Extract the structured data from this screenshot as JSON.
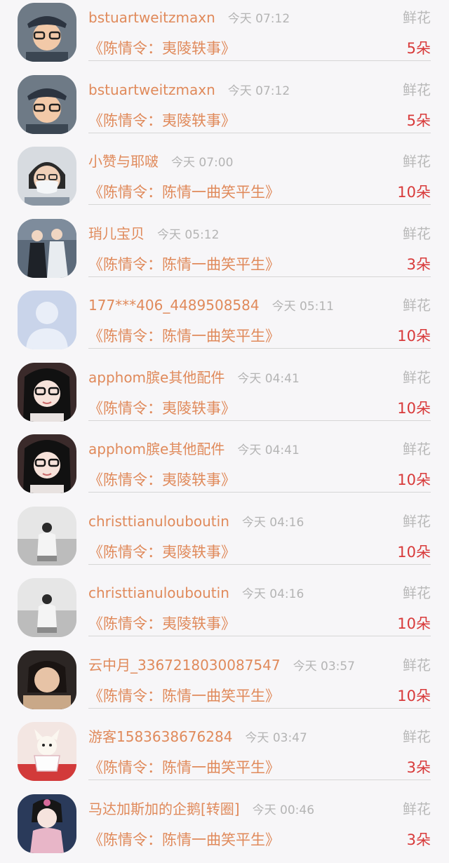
{
  "colors": {
    "background": "#f7f6f8",
    "name": "#e08a5b",
    "time": "#b4b4b4",
    "gift_label": "#b9b9b9",
    "count": "#d83a3a",
    "divider": "#d6d6d6"
  },
  "entries": [
    {
      "name": "bstuartweitzmaxn",
      "time": "今天 07:12",
      "gift": "鲜花",
      "work": "《陈情令：夷陵轶事》",
      "count": "5朵",
      "avatar": "boy-glasses-avatar"
    },
    {
      "name": "bstuartweitzmaxn",
      "time": "今天 07:12",
      "gift": "鲜花",
      "work": "《陈情令：夷陵轶事》",
      "count": "5朵",
      "avatar": "boy-glasses-avatar"
    },
    {
      "name": "小赞与耶啵",
      "time": "今天 07:00",
      "gift": "鲜花",
      "work": "《陈情令：陈情一曲笑平生》",
      "count": "10朵",
      "avatar": "masked-person-avatar"
    },
    {
      "name": "琑儿宝贝",
      "time": "今天 05:12",
      "gift": "鲜花",
      "work": "《陈情令：陈情一曲笑平生》",
      "count": "3朵",
      "avatar": "costume-pair-avatar"
    },
    {
      "name": "177***406_4489508584",
      "time": "今天 05:11",
      "gift": "鲜花",
      "work": "《陈情令：陈情一曲笑平生》",
      "count": "10朵",
      "avatar": "default-user-avatar"
    },
    {
      "name": "apphom膑e其他配件",
      "time": "今天 04:41",
      "gift": "鲜花",
      "work": "《陈情令：夷陵轶事》",
      "count": "10朵",
      "avatar": "girl-glasses-avatar"
    },
    {
      "name": "apphom膑e其他配件",
      "time": "今天 04:41",
      "gift": "鲜花",
      "work": "《陈情令：夷陵轶事》",
      "count": "10朵",
      "avatar": "girl-glasses-avatar"
    },
    {
      "name": "christtianulouboutin",
      "time": "今天 04:16",
      "gift": "鲜花",
      "work": "《陈情令：夷陵轶事》",
      "count": "10朵",
      "avatar": "seaside-man-avatar"
    },
    {
      "name": "christtianulouboutin",
      "time": "今天 04:16",
      "gift": "鲜花",
      "work": "《陈情令：夷陵轶事》",
      "count": "10朵",
      "avatar": "seaside-man-avatar"
    },
    {
      "name": "云中月_3367218030087547",
      "time": "今天 03:57",
      "gift": "鲜花",
      "work": "《陈情令：陈情一曲笑平生》",
      "count": "10朵",
      "avatar": "woman-portrait-avatar"
    },
    {
      "name": "游客1583638676284",
      "time": "今天 03:47",
      "gift": "鲜花",
      "work": "《陈情令：陈情一曲笑平生》",
      "count": "3朵",
      "avatar": "puppy-teacup-avatar"
    },
    {
      "name": "马达加斯加的企鹅[转圈]",
      "time": "今天 00:46",
      "gift": "鲜花",
      "work": "《陈情令：陈情一曲笑平生》",
      "count": "3朵",
      "avatar": "costume-girl-avatar"
    }
  ]
}
